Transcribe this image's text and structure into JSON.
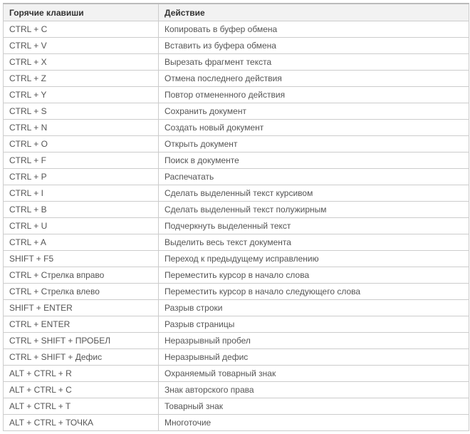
{
  "headers": {
    "hotkey": "Горячие клавиши",
    "action": "Действие"
  },
  "rows": [
    {
      "hotkey": "CTRL + C",
      "action": "Копировать в буфер обмена"
    },
    {
      "hotkey": "CTRL + V",
      "action": "Вставить из буфера обмена"
    },
    {
      "hotkey": "CTRL + X",
      "action": "Вырезать фрагмент текста"
    },
    {
      "hotkey": "CTRL + Z",
      "action": "Отмена последнего действия"
    },
    {
      "hotkey": "CTRL + Y",
      "action": "Повтор отмененного действия"
    },
    {
      "hotkey": "CTRL + S",
      "action": "Сохранить документ"
    },
    {
      "hotkey": "CTRL + N",
      "action": "Создать новый документ"
    },
    {
      "hotkey": "CTRL + O",
      "action": "Открыть документ"
    },
    {
      "hotkey": "CTRL + F",
      "action": "Поиск в документе"
    },
    {
      "hotkey": "CTRL + P",
      "action": "Распечатать"
    },
    {
      "hotkey": "CTRL + I",
      "action": "Сделать выделенный текст курсивом"
    },
    {
      "hotkey": "CTRL + B",
      "action": "Сделать выделенный текст полужирным"
    },
    {
      "hotkey": "CTRL + U",
      "action": "Подчеркнуть выделенный текст"
    },
    {
      "hotkey": "CTRL + A",
      "action": "Выделить весь текст документа"
    },
    {
      "hotkey": "SHIFT + F5",
      "action": "Переход к предыдущему исправлению"
    },
    {
      "hotkey": "CTRL + Стрелка вправо",
      "action": "Переместить курсор в начало слова"
    },
    {
      "hotkey": "CTRL + Стрелка влево",
      "action": "Переместить курсор в начало следующего слова"
    },
    {
      "hotkey": "SHIFT + ENTER",
      "action": "Разрыв строки"
    },
    {
      "hotkey": "CTRL + ENTER",
      "action": "Разрыв страницы"
    },
    {
      "hotkey": "CTRL + SHIFT + ПРОБЕЛ",
      "action": "Неразрывный пробел"
    },
    {
      "hotkey": "CTRL + SHIFT + Дефис",
      "action": "Неразрывный дефис"
    },
    {
      "hotkey": "ALT + CTRL + R",
      "action": "Охраняемый товарный знак"
    },
    {
      "hotkey": "ALT + CTRL + C",
      "action": "Знак авторского права"
    },
    {
      "hotkey": "ALT + CTRL + T",
      "action": "Товарный знак"
    },
    {
      "hotkey": "ALT + CTRL + ТОЧКА",
      "action": "Многоточие"
    }
  ]
}
